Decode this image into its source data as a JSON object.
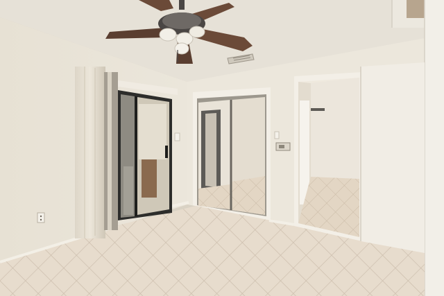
{
  "scene": {
    "kind": "room-photo",
    "colors": {
      "ceiling": "#e6e1d7",
      "wall_left": "#e9e3d6",
      "wall_back": "#ece7dc",
      "floor": "#e7dccd",
      "grout": "#cdbfae",
      "fan_blade": "#6b4a38",
      "fan_metal": "#4a4644",
      "glass": "#5b5a55",
      "trim": "#f3efe7"
    },
    "icons": [
      "ceiling-fan-icon",
      "air-vent-icon",
      "light-switch-icon",
      "thermostat-icon",
      "outlet-icon"
    ]
  }
}
